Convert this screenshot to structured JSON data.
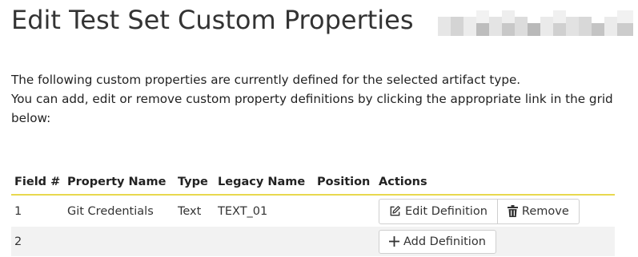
{
  "page": {
    "title": "Edit Test Set Custom Properties"
  },
  "intro": {
    "line1": "The following custom properties are currently defined for the selected artifact type.",
    "line2": "You can add, edit or remove custom property definitions by clicking the appropriate link in the grid below:"
  },
  "table": {
    "headers": [
      "Field #",
      "Property Name",
      "Type",
      "Legacy Name",
      "Position",
      "Actions"
    ],
    "rows": [
      {
        "field": "1",
        "property_name": "Git Credentials",
        "type": "Text",
        "legacy_name": "TEXT_01",
        "position": "",
        "edit_label": "Edit Definition",
        "remove_label": "Remove"
      },
      {
        "field": "2",
        "property_name": "",
        "type": "",
        "legacy_name": "",
        "position": "",
        "add_label": "Add Definition"
      }
    ]
  },
  "colors": {
    "header_rule": "#e8d84e",
    "alt_row": "#f2f2f2"
  },
  "icons": {
    "edit": "edit-icon",
    "remove": "trash-icon",
    "add": "plus-icon"
  }
}
